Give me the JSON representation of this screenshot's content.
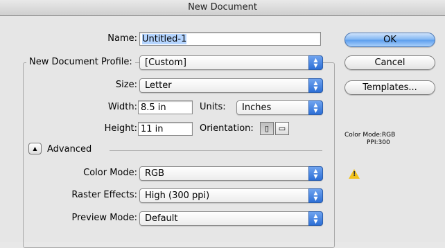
{
  "window": {
    "title": "New Document"
  },
  "fields": {
    "name": {
      "label": "Name:",
      "value": "Untitled-1"
    },
    "profile": {
      "label": "New Document Profile:",
      "value": "[Custom]"
    },
    "size": {
      "label": "Size:",
      "value": "Letter"
    },
    "width": {
      "label": "Width:",
      "value": "8.5 in"
    },
    "units": {
      "label": "Units:",
      "value": "Inches"
    },
    "height": {
      "label": "Height:",
      "value": "11 in"
    },
    "orientation": {
      "label": "Orientation:"
    },
    "advanced": {
      "label": "Advanced"
    },
    "color_mode": {
      "label": "Color Mode:",
      "value": "RGB"
    },
    "raster_effects": {
      "label": "Raster Effects:",
      "value": "High (300 ppi)"
    },
    "preview_mode": {
      "label": "Preview Mode:",
      "value": "Default"
    }
  },
  "buttons": {
    "ok": "OK",
    "cancel": "Cancel",
    "templates": "Templates..."
  },
  "summary": {
    "color_mode": "Color Mode:RGB",
    "ppi": "PPI:300"
  },
  "icons": {
    "popup_arrows": "up-down-arrows",
    "warning": "warning-icon",
    "portrait": "portrait-icon",
    "landscape": "landscape-icon"
  }
}
